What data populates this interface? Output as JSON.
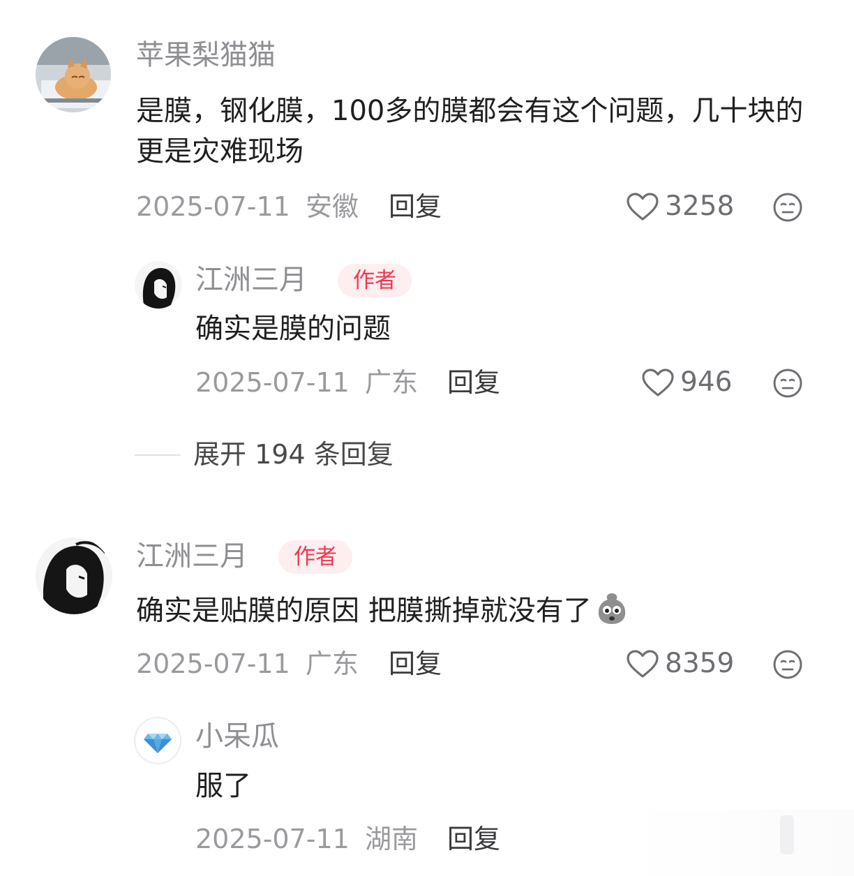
{
  "comments": [
    {
      "user": "苹果梨猫猫",
      "text": "是膜，钢化膜，100多的膜都会有这个问题，几十块的更是灾难现场",
      "date": "2025-07-11",
      "location": "安徽",
      "reply_label": "回复",
      "likes": "3258",
      "avatar_icon": "cat-photo-avatar",
      "replies": [
        {
          "user": "江洲三月",
          "tag": "作者",
          "text": "确实是膜的问题",
          "date": "2025-07-11",
          "location": "广东",
          "reply_label": "回复",
          "likes": "946"
        }
      ],
      "expand": {
        "prefix": "展开",
        "count": "194",
        "suffix": "条回复"
      }
    },
    {
      "user": "江洲三月",
      "tag": "作者",
      "text": "确实是贴膜的原因 把膜撕掉就没有了",
      "text_emoji_icon": "frightened-face-emoji",
      "date": "2025-07-11",
      "location": "广东",
      "reply_label": "回复",
      "likes": "8359",
      "replies": [
        {
          "user": "小呆瓜",
          "text": "服了",
          "date": "2025-07-11",
          "location": "湖南",
          "reply_label": "回复",
          "avatar_icon": "diamond-icon"
        }
      ]
    }
  ],
  "colors": {
    "author_tag_bg": "#fdeef0",
    "author_tag_text": "#f1394f",
    "meta": "#9a9a9e",
    "username": "#8e8e93"
  }
}
